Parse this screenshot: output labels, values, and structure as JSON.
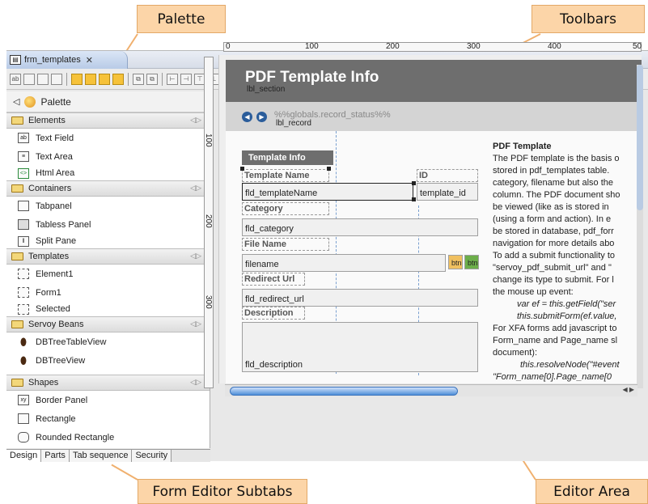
{
  "callouts": {
    "palette": "Palette",
    "toolbars": "Toolbars",
    "subtabs": "Form Editor Subtabs",
    "editor_area": "Editor Area"
  },
  "editor_tab": {
    "title": "frm_templates"
  },
  "palette": {
    "title": "Palette",
    "sections": [
      {
        "name": "Elements",
        "items": [
          "Text Field",
          "Text Area",
          "Html Area"
        ]
      },
      {
        "name": "Containers",
        "items": [
          "Tabpanel",
          "Tabless Panel",
          "Split Pane"
        ]
      },
      {
        "name": "Templates",
        "items": [
          "Element1",
          "Form1",
          "Selected"
        ]
      },
      {
        "name": "Servoy Beans",
        "items": [
          "DBTreeTableView",
          "DBTreeView"
        ]
      },
      {
        "name": "Shapes",
        "items": [
          "Border Panel",
          "Rectangle",
          "Rounded Rectangle"
        ]
      }
    ]
  },
  "subtabs": [
    "Design",
    "Parts",
    "Tab sequence",
    "Security"
  ],
  "ruler": {
    "top": [
      "0",
      "100",
      "200",
      "300",
      "400",
      "50"
    ],
    "left": [
      "100",
      "200",
      "300"
    ]
  },
  "form": {
    "title": "PDF Template Info",
    "lbl_section": "lbl_section",
    "record_status": "%%globals.record_status%%",
    "lbl_record": "lbl_record",
    "info_bar": "Template Info",
    "labels": {
      "template_name": "Template Name",
      "id": "ID",
      "category": "Category",
      "file_name": "File Name",
      "redirect_url": "Redirect Url",
      "description": "Description"
    },
    "fields": {
      "template_name": "fld_templateName",
      "template_id": "template_id",
      "category": "fld_category",
      "filename": "filename",
      "redirect_url": "fld_redirect_url",
      "description": "fld_description"
    },
    "file_buttons": [
      "btn",
      "btn"
    ]
  },
  "right_text": {
    "title": "PDF Template",
    "lines": [
      "The PDF template is the basis o",
      "stored in pdf_templates table.",
      "category, filename but also the",
      "column. The PDF document sho",
      "be viewed (like as is stored in",
      "(using a form and action). In e",
      "be stored in database, pdf_forr",
      "navigation for more details abo",
      "To add a submit functionality to",
      "\"servoy_pdf_submit_url\" and \"",
      "change its type to submit. For l",
      "the mouse up event:"
    ],
    "code1": "var ef = this.getField(\"ser",
    "code2": "this.submitForm(ef.value,",
    "lines2": [
      "For XFA forms add javascript to",
      "Form_name and Page_name sl",
      "document):"
    ],
    "code3": "this.resolveNode(\"#event",
    "code4": "\"Form_name[0].Page_name[0"
  }
}
